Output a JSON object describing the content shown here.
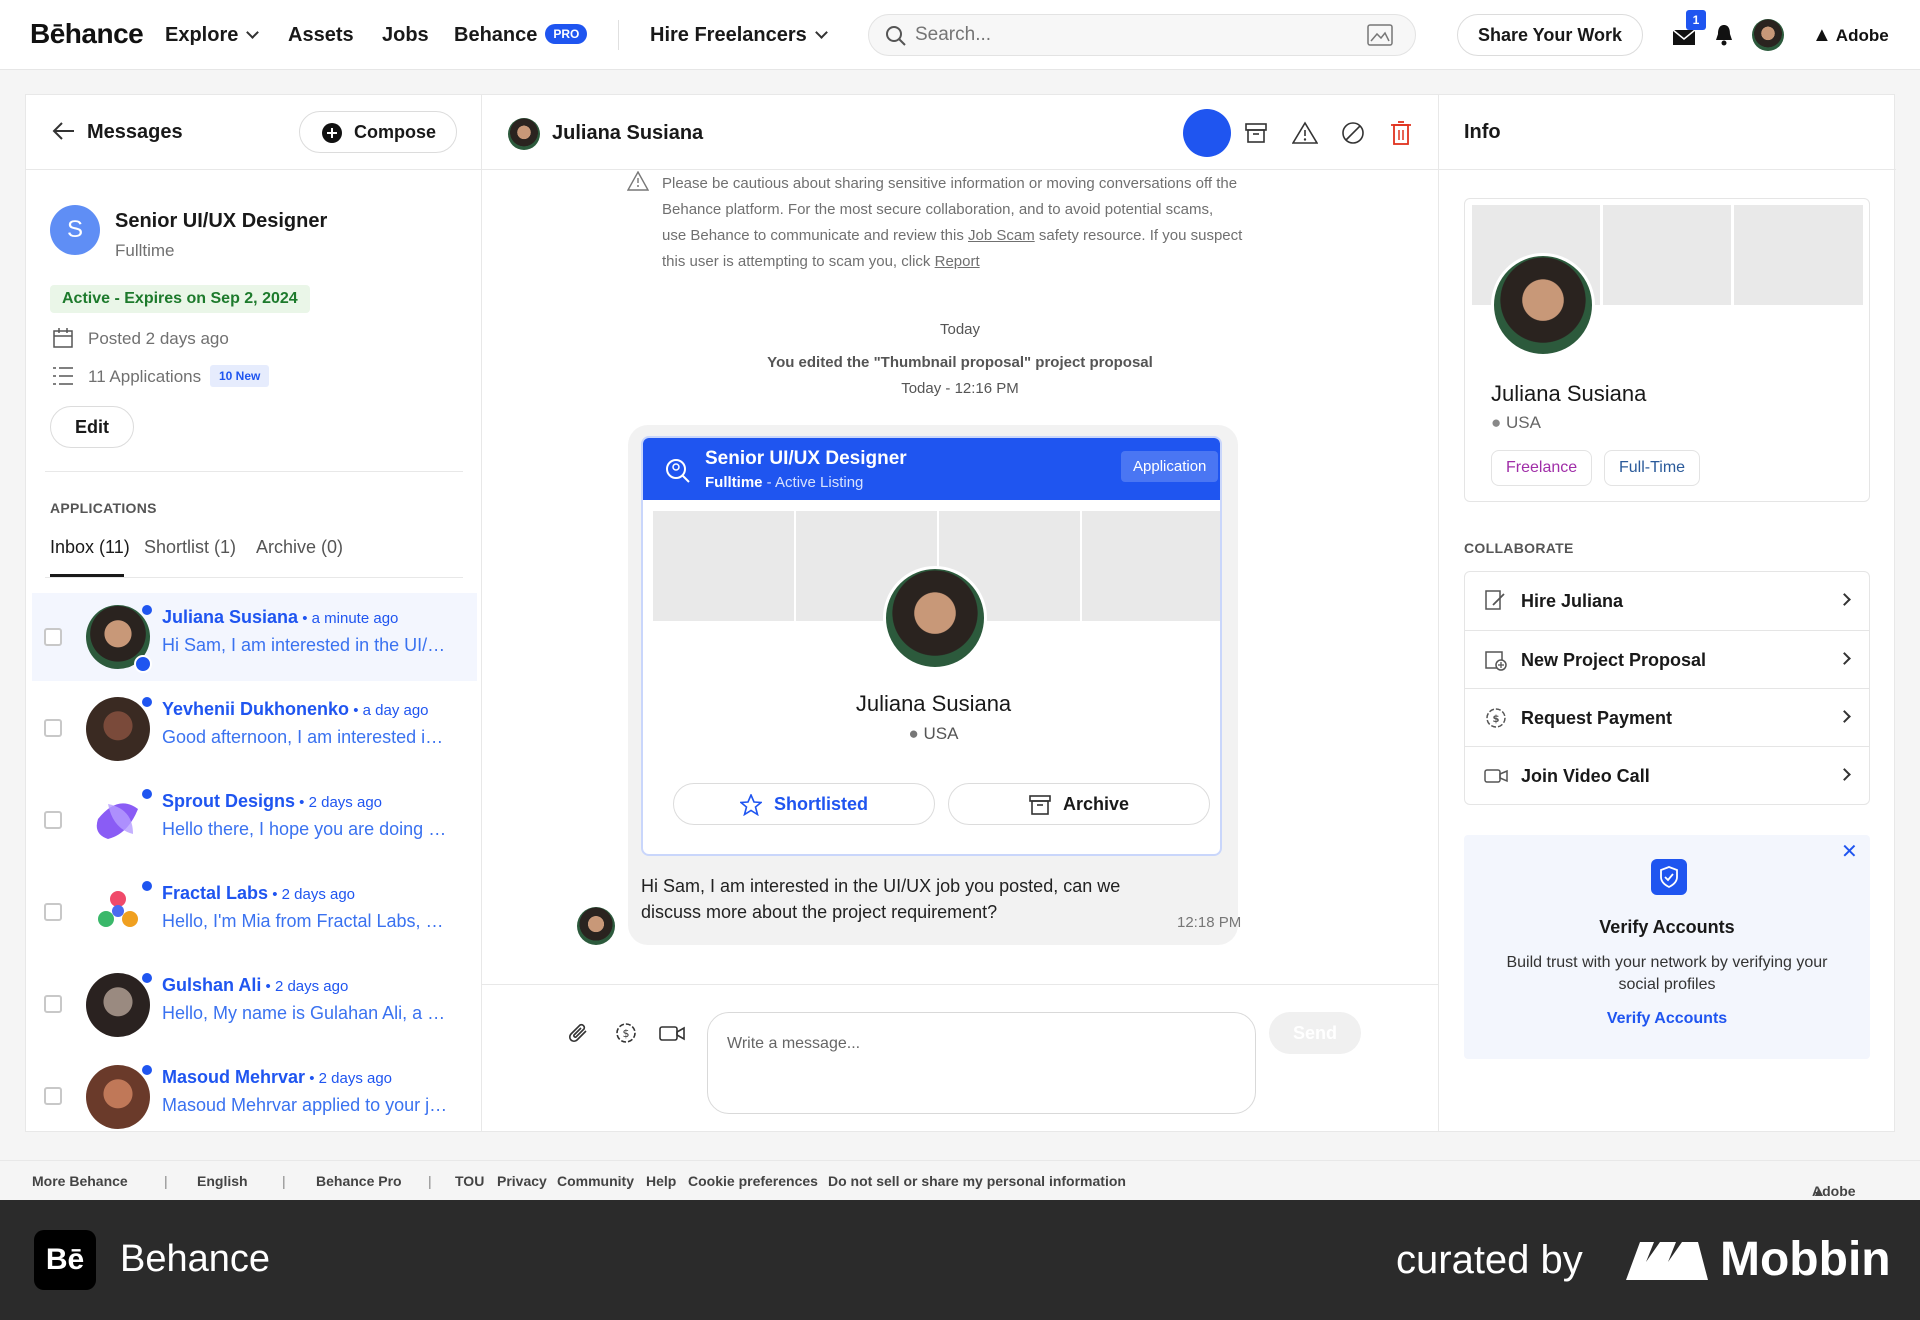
{
  "nav": {
    "logo": "Bēhance",
    "explore": "Explore",
    "assets": "Assets",
    "jobs": "Jobs",
    "behance": "Behance",
    "pro_badge": "PRO",
    "hire": "Hire Freelancers",
    "search_placeholder": "Search...",
    "share": "Share Your Work",
    "mail_count": "1",
    "adobe": "Adobe"
  },
  "left": {
    "title": "Messages",
    "compose": "Compose",
    "job": {
      "initial": "S",
      "title": "Senior UI/UX Designer",
      "type": "Fulltime",
      "status": "Active - Expires on Sep 2, 2024",
      "posted": "Posted 2 days ago",
      "applications": "11 Applications",
      "new_badge": "10 New",
      "edit": "Edit"
    },
    "applications_label": "APPLICATIONS",
    "tabs": [
      "Inbox (11)",
      "Shortlist (1)",
      "Archive (0)"
    ],
    "conversations": [
      {
        "name": "Juliana Susiana",
        "time": "a minute ago",
        "message": "Hi Sam, I am interested in the UI/UX job you posted, can we"
      },
      {
        "name": "Yevhenii Dukhonenko",
        "time": "a day ago",
        "message": "Good afternoon, I am interested in the role"
      },
      {
        "name": "Sprout Designs",
        "time": "2 days ago",
        "message": "Hello there, I hope you are doing well today"
      },
      {
        "name": "Fractal Labs",
        "time": "2 days ago",
        "message": "Hello, I'm Mia from Fractal Labs, a design studio"
      },
      {
        "name": "Gulshan Ali",
        "time": "2 days ago",
        "message": "Hello, My name is Gulahan Ali, a product designer"
      },
      {
        "name": "Masoud Mehrvar",
        "time": "2 days ago",
        "message": "Masoud Mehrvar applied to your job listing"
      }
    ]
  },
  "chat": {
    "contact": "Juliana Susiana",
    "warning_1": "Please be cautious about sharing sensitive information or moving conversations off the",
    "warning_2": "Behance platform. For the most secure collaboration, and to avoid potential scams,",
    "warning_3a": "use Behance to communicate and review this ",
    "warning_link1": "Job Scam",
    "warning_3b": " safety resource. If you suspect",
    "warning_4": "this user is attempting to scam you, click",
    "warning_link2": "Report",
    "day": "Today",
    "event": "You edited the \"Thumbnail proposal\" project proposal",
    "event_time": "Today - 12:16 PM",
    "card": {
      "title": "Senior UI/UX Designer",
      "type": "Fulltime",
      "listing": " - Active Listing",
      "badge": "Application",
      "name": "Juliana Susiana",
      "location": "USA",
      "shortlisted": "Shortlisted",
      "archive": "Archive"
    },
    "message_1": "Hi Sam, I am interested in the UI/UX job you posted, can we",
    "message_2": "discuss more about the project requirement?",
    "message_time": "12:18 PM",
    "input_placeholder": "Write a message...",
    "send": "Send"
  },
  "info": {
    "title": "Info",
    "name": "Juliana Susiana",
    "location": "USA",
    "tag1": "Freelance",
    "tag2": "Full-Time",
    "collab_label": "COLLABORATE",
    "actions": [
      "Hire Juliana",
      "New Project Proposal",
      "Request Payment",
      "Join Video Call"
    ],
    "verify_title": "Verify Accounts",
    "verify_text1": "Build trust with your network by verifying your",
    "verify_text2": "social profiles",
    "verify_link": "Verify Accounts"
  },
  "footer": {
    "more": "More Behance",
    "lang": "English",
    "pro": "Behance Pro",
    "links": [
      "TOU",
      "Privacy",
      "Community",
      "Help",
      "Cookie preferences",
      "Do not sell or share my personal information"
    ],
    "adobe": "Adobe"
  },
  "brand": {
    "left": "Behance",
    "curated": "curated by",
    "right": "Mobbin"
  },
  "colors": {
    "accent": "#1f55f0",
    "active_green": "#1d7a2c",
    "danger": "#e0321e"
  }
}
